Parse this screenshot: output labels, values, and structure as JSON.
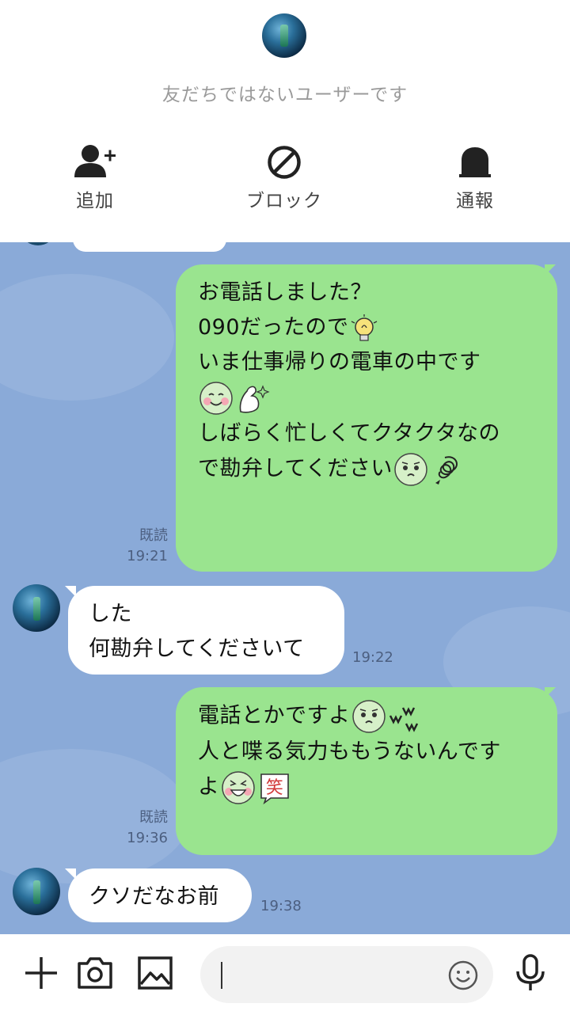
{
  "header": {
    "notice": "友だちではないユーザーです",
    "actions": [
      {
        "label": "追加",
        "icon": "add-friend-icon"
      },
      {
        "label": "ブロック",
        "icon": "block-icon"
      },
      {
        "label": "通報",
        "icon": "report-icon"
      }
    ]
  },
  "messages": [
    {
      "sender": "me",
      "lines": [
        "お電話しました？",
        "090だったので",
        "",
        "いま仕事帰りの電車の中です",
        "",
        "",
        "しばらく忙しくてクタクタなの",
        "で勘弁してください"
      ],
      "read": "既読",
      "time": "19:21"
    },
    {
      "sender": "other",
      "lines": [
        "した",
        "何勘弁してくださいて"
      ],
      "time": "19:22"
    },
    {
      "sender": "me",
      "lines": [
        "電話とかですよ",
        "",
        "人と喋る気力ももうないんです",
        "よ"
      ],
      "read": "既読",
      "time": "19:36"
    },
    {
      "sender": "other",
      "lines": [
        "クソだなお前"
      ],
      "time": "19:38"
    }
  ],
  "emoji": {
    "laugh_char": "笑"
  },
  "bottom": {
    "icons": [
      "plus-icon",
      "camera-icon",
      "image-icon",
      "emoji-icon",
      "microphone-icon"
    ]
  },
  "colors": {
    "chat_background": "#8aaad8",
    "my_bubble": "#9ae48f",
    "other_bubble": "#ffffff"
  }
}
